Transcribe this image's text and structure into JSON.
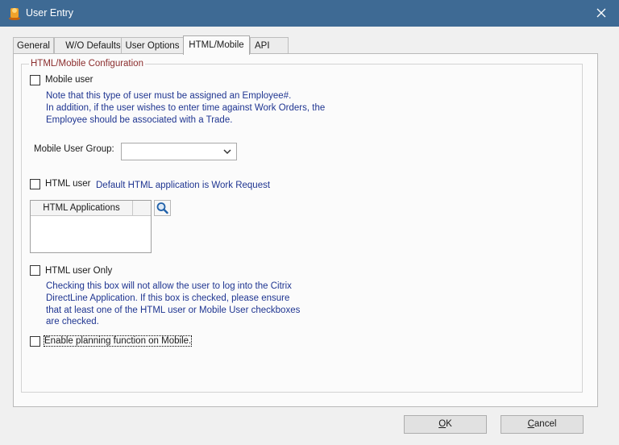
{
  "window": {
    "title": "User Entry",
    "titlebar_color": "#3e6a94",
    "icons": {
      "app": "user-entry-app-icon",
      "close": "close-icon"
    }
  },
  "tabs": [
    {
      "label": "General",
      "active": false
    },
    {
      "label": "W/O Defaults",
      "active": false
    },
    {
      "label": "User Options",
      "active": false
    },
    {
      "label": "HTML/Mobile",
      "active": true
    },
    {
      "label": "API",
      "active": false
    }
  ],
  "group": {
    "title": "HTML/Mobile Configuration",
    "title_color": "#8b2d2d"
  },
  "mobile_user": {
    "label": "Mobile user",
    "checked": false,
    "note_lines": [
      "Note that this type of user must be assigned an Employee#.",
      "In addition, if the user wishes to enter time against Work Orders, the",
      "Employee should be associated with a Trade."
    ]
  },
  "mobile_user_group": {
    "label": "Mobile User Group:",
    "value": ""
  },
  "html_user": {
    "label": "HTML user",
    "checked": false,
    "note": "Default HTML application is Work Request"
  },
  "html_applications": {
    "header": "HTML Applications",
    "rows": [],
    "search_icon": "magnifier-icon"
  },
  "html_user_only": {
    "label": "HTML user Only",
    "checked": false,
    "note_lines": [
      "Checking this box will not allow the user to log into the Citrix",
      "DirectLine Application.  If this box is checked, please ensure",
      "that at least one of the HTML user or Mobile User checkboxes",
      "are checked."
    ]
  },
  "planning": {
    "label": "Enable planning function on Mobile.",
    "checked": false
  },
  "buttons": {
    "ok": {
      "label": "OK",
      "mnemonic": "O",
      "rest": "K"
    },
    "cancel": {
      "label": "Cancel",
      "mnemonic": "C",
      "rest": "ancel"
    }
  },
  "note_color": "#1f3591"
}
